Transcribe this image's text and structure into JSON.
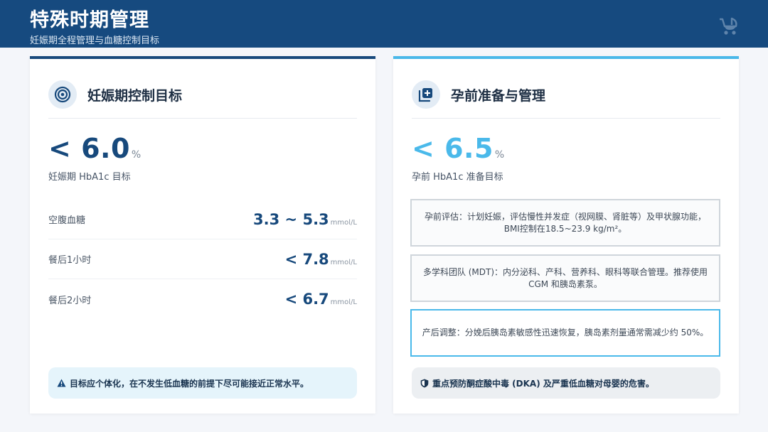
{
  "header": {
    "title": "特殊时期管理",
    "subtitle": "妊娠期全程管理与血糖控制目标",
    "icon": "baby-carriage-icon"
  },
  "colors": {
    "header_bg": "#164a7f",
    "accent_dark": "#17497c",
    "accent_light": "#4ab9ea"
  },
  "left_card": {
    "title": "妊娠期控制目标",
    "icon": "target-icon",
    "big_value": "< 6.0",
    "big_unit": "%",
    "big_label": "妊娠期 HbA1c 目标",
    "rows": [
      {
        "label": "空腹血糖",
        "value": "3.3 ~ 5.3",
        "unit": "mmol/L"
      },
      {
        "label": "餐后1小时",
        "value": "< 7.8",
        "unit": "mmol/L"
      },
      {
        "label": "餐后2小时",
        "value": "< 6.7",
        "unit": "mmol/L"
      }
    ],
    "alert_icon": "warning-icon",
    "alert": "目标应个体化，在不发生低血糖的前提下尽可能接近正常水平。"
  },
  "right_card": {
    "title": "孕前准备与管理",
    "icon": "medical-plus-icon",
    "big_value": "< 6.5",
    "big_unit": "%",
    "big_label": "孕前 HbA1c 准备目标",
    "boxes": [
      {
        "text": "孕前评估：计划妊娠，评估慢性并发症（视网膜、肾脏等）及甲状腺功能，BMI控制在18.5~23.9 kg/m²。"
      },
      {
        "text": "多学科团队 (MDT)：内分泌科、产科、营养科、眼科等联合管理。推荐使用 CGM 和胰岛素泵。"
      },
      {
        "text": "产后调整：分娩后胰岛素敏感性迅速恢复，胰岛素剂量通常需减少约 50%。"
      }
    ],
    "alert_icon": "shield-icon",
    "alert": "重点预防酮症酸中毒 (DKA) 及严重低血糖对母婴的危害。"
  }
}
